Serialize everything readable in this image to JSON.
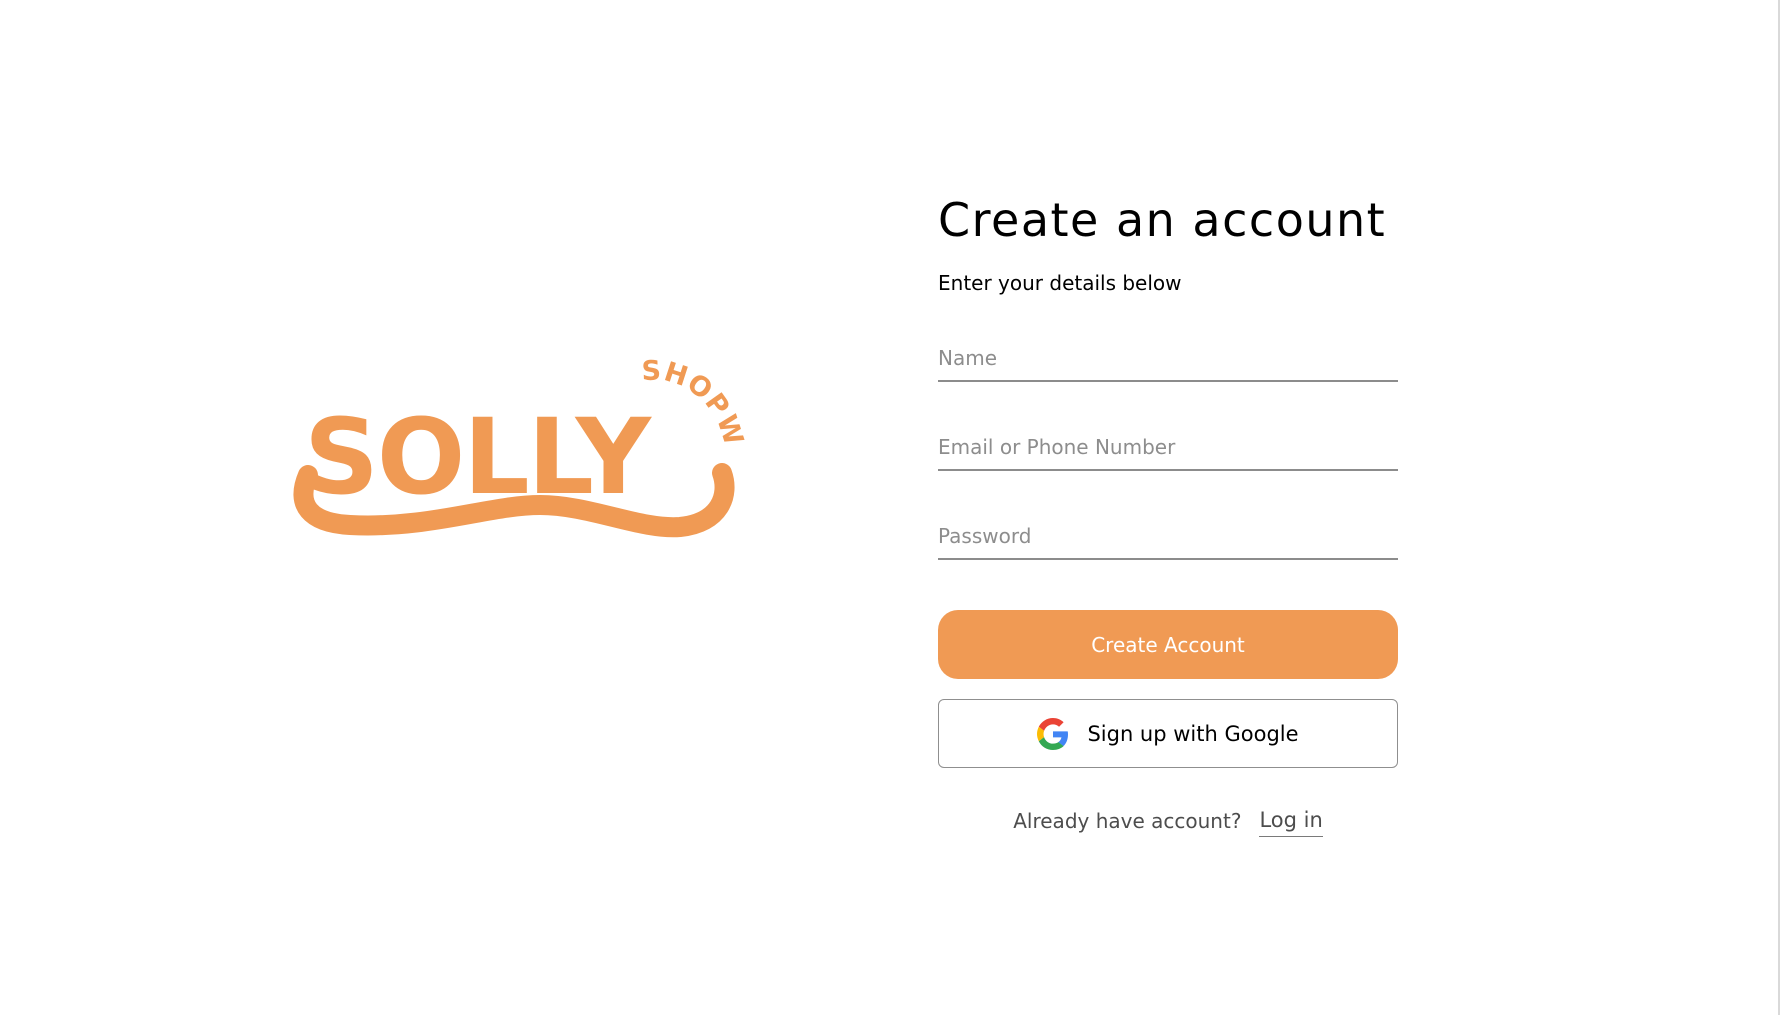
{
  "brand": {
    "logo_main": "SOLLY",
    "logo_arc": "SHOPWE",
    "accent_color": "#f09a54"
  },
  "form": {
    "title": "Create an account",
    "subtitle": "Enter your details below",
    "name_placeholder": "Name",
    "name_value": "",
    "email_placeholder": "Email or Phone Number",
    "email_value": "",
    "password_placeholder": "Password",
    "password_value": "",
    "create_label": "Create Account",
    "google_label": "Sign up with Google",
    "google_icon": "google-icon",
    "footer_text": "Already have account?",
    "login_label": "Log in"
  }
}
